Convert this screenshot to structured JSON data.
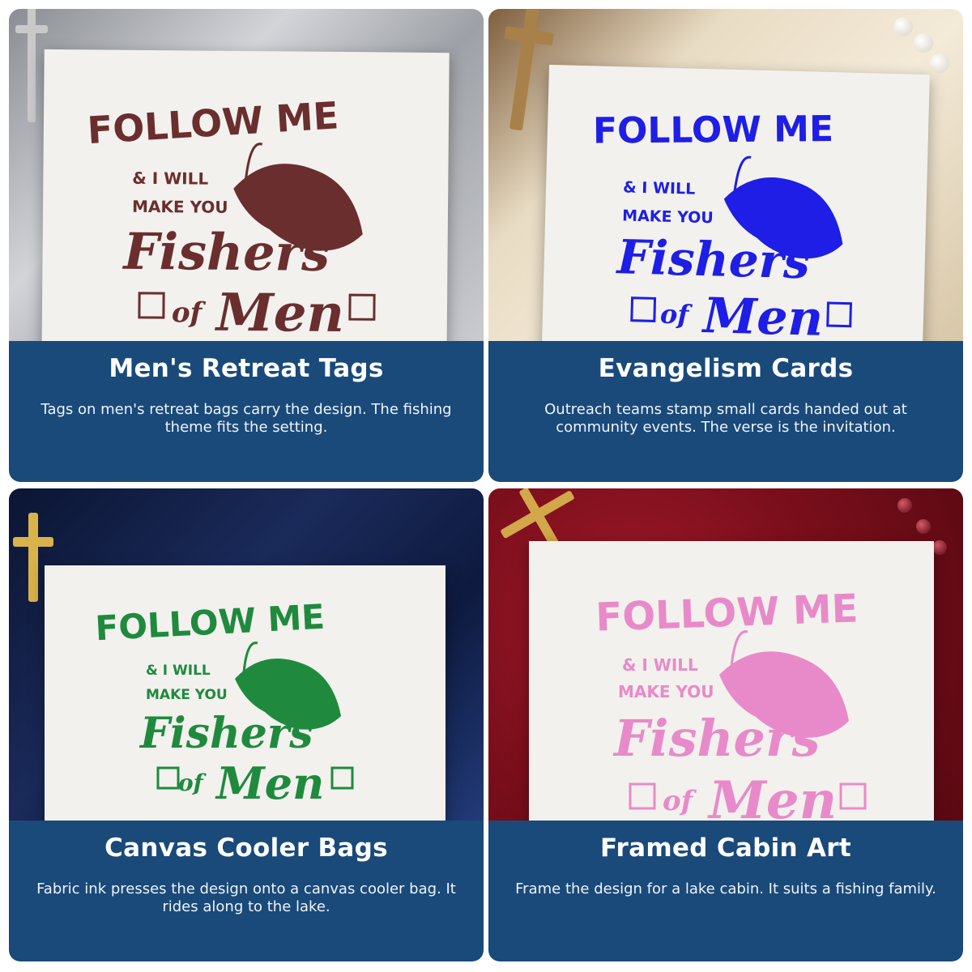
{
  "cards": [
    {
      "title": "Men's Retreat Tags",
      "description": "Tags on men's retreat bags carry the design. The fishing theme fits the setting.",
      "ink_color": "#6a2e2e",
      "stamp": {
        "line1": "FOLLOW ME",
        "line2": "& I WILL",
        "line3": "MAKE YOU",
        "line4": "Fishers",
        "line5": "of",
        "line6": "Men"
      }
    },
    {
      "title": "Evangelism Cards",
      "description": "Outreach teams stamp small cards handed out at community events. The verse is the invitation.",
      "ink_color": "#1e1ee6",
      "stamp": {
        "line1": "FOLLOW ME",
        "line2": "& I WILL",
        "line3": "MAKE YOU",
        "line4": "Fishers",
        "line5": "of",
        "line6": "Men"
      }
    },
    {
      "title": "Canvas Cooler Bags",
      "description": "Fabric ink presses the design onto a canvas cooler bag. It rides along to the lake.",
      "ink_color": "#1f8a3e",
      "stamp": {
        "line1": "FOLLOW ME",
        "line2": "& I WILL",
        "line3": "MAKE YOU",
        "line4": "Fishers",
        "line5": "of",
        "line6": "Men"
      }
    },
    {
      "title": "Framed Cabin Art",
      "description": "Frame the design for a lake cabin. It suits a fishing family.",
      "ink_color": "#e88ac9",
      "stamp": {
        "line1": "FOLLOW ME",
        "line2": "& I WILL",
        "line3": "MAKE YOU",
        "line4": "Fishers",
        "line5": "of",
        "line6": "Men"
      }
    }
  ],
  "colors": {
    "panel": "#194a7a",
    "panel_text": "#ffffff"
  }
}
